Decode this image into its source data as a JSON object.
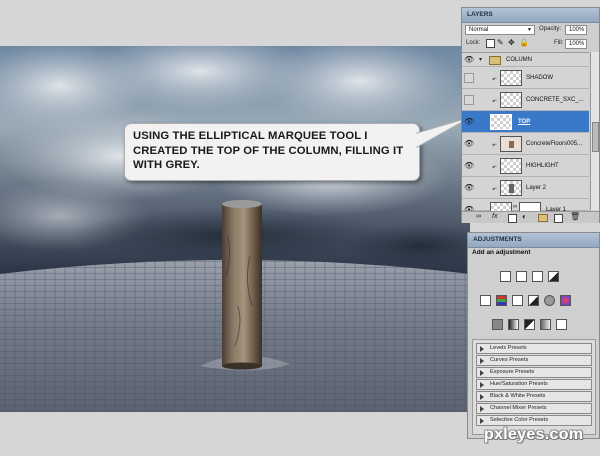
{
  "callout": {
    "text": "USING THE ELLIPTICAL MARQUEE TOOL I CREATED THE TOP OF THE COLUMN, FILLING IT WITH GREY."
  },
  "layers_panel": {
    "tab": "LAYERS",
    "blend_mode": "Normal",
    "opacity_label": "Opacity:",
    "opacity_value": "100%",
    "lock_label": "Lock:",
    "fill_label": "Fill:",
    "fill_value": "100%",
    "layers": [
      {
        "name": "COLUMN",
        "type": "group",
        "visible": true,
        "selected": false
      },
      {
        "name": "SHADOW",
        "type": "layer",
        "visible": false,
        "selected": false
      },
      {
        "name": "CONCRETE_SXC_...",
        "type": "layer",
        "visible": false,
        "selected": false
      },
      {
        "name": "TOP",
        "type": "layer",
        "visible": true,
        "selected": true
      },
      {
        "name": "ConcreteFloors005...",
        "type": "layer",
        "visible": true,
        "selected": false
      },
      {
        "name": "HIGHLIGHT",
        "type": "layer",
        "visible": true,
        "selected": false
      },
      {
        "name": "Layer 2",
        "type": "layer",
        "visible": true,
        "selected": false
      },
      {
        "name": "Layer 1",
        "type": "layer",
        "visible": true,
        "selected": false
      }
    ]
  },
  "adjustments_panel": {
    "tab": "ADJUSTMENTS",
    "heading": "Add an adjustment",
    "presets": [
      "Levels Presets",
      "Curves Presets",
      "Exposure Presets",
      "Hue/Saturation Presets",
      "Black & White Presets",
      "Channel Mixer Presets",
      "Selective Color Presets"
    ]
  },
  "watermark": "pxleyes.com",
  "colors": {
    "selection_blue": "#3a78c8",
    "panel_gray": "#cfcfcf",
    "tab_blue": "#a3b5cc"
  }
}
